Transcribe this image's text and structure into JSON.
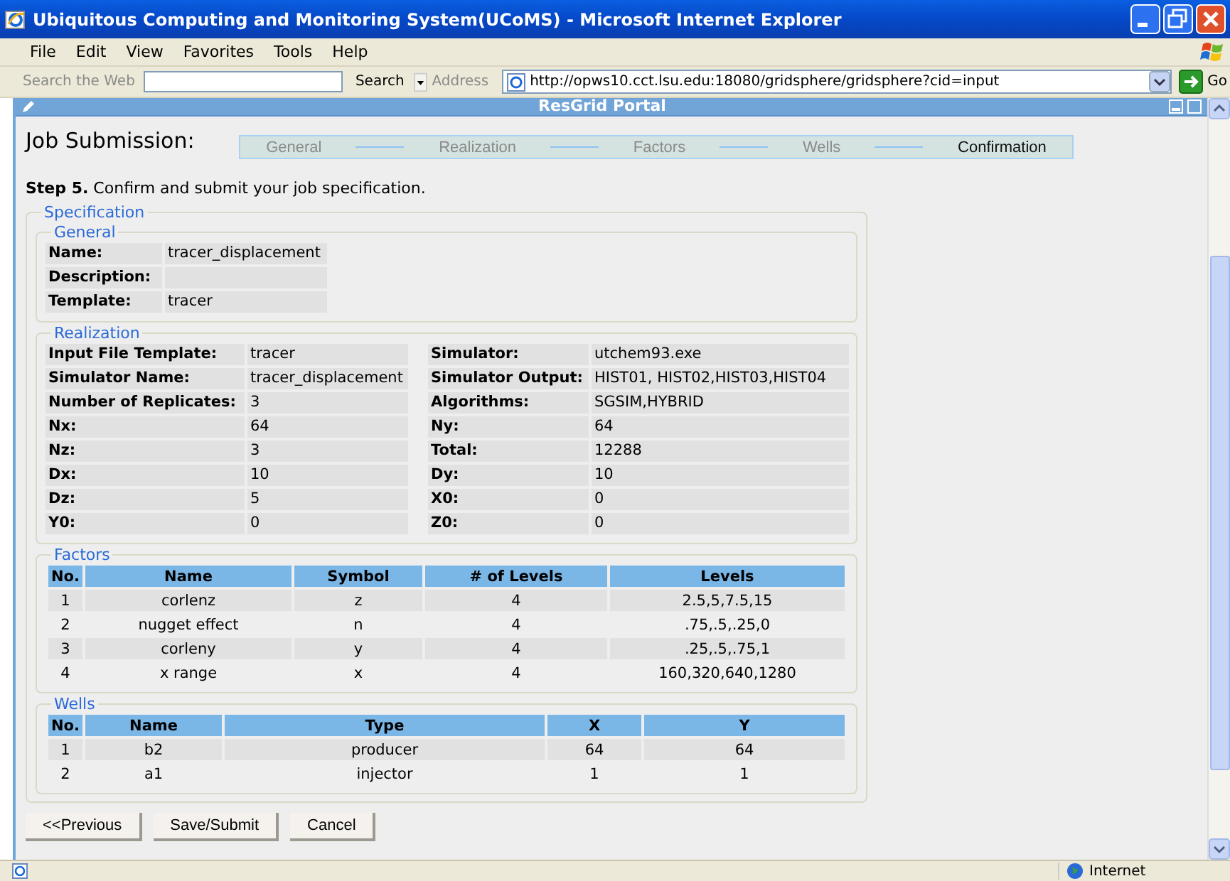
{
  "window": {
    "title": "Ubiquitous Computing and Monitoring System(UCoMS) - Microsoft Internet Explorer"
  },
  "menu": [
    "File",
    "Edit",
    "View",
    "Favorites",
    "Tools",
    "Help"
  ],
  "toolbar": {
    "search_label": "Search the Web",
    "search_button": "Search",
    "address_label": "Address",
    "address": "http://opws10.cct.lsu.edu:18080/gridsphere/gridsphere?cid=input",
    "go": "Go"
  },
  "portal": {
    "title": "ResGrid Portal"
  },
  "page": {
    "heading": "Job Submission:",
    "steps": [
      {
        "label": "General",
        "selected": false
      },
      {
        "label": "Realization",
        "selected": false
      },
      {
        "label": "Factors",
        "selected": false
      },
      {
        "label": "Wells",
        "selected": false
      },
      {
        "label": "Confirmation",
        "selected": true
      }
    ],
    "instruction": "**Step 5.** Confirm and submit your job specification.",
    "specification": {
      "legend": "Specification",
      "general": {
        "legend": "General",
        "fields": [
          {
            "label": "Name:",
            "value": "tracer_displacement"
          },
          {
            "label": "Description:"
          },
          {
            "label": "Template:",
            "value": "tracer"
          }
        ]
      },
      "realization": {
        "legend": "Realization",
        "fields": [
          {
            "label": "Input File Template:",
            "value": "tracer"
          },
          {
            "label": "Simulator:",
            "value": "utchem93.exe"
          },
          {
            "label": "Simulator Name:",
            "value": "tracer_displacement"
          },
          {
            "label": "Simulator Output:",
            "value": "HIST01, HIST02,HIST03,HIST04"
          },
          {
            "label": "Number of Replicates:",
            "value": "3"
          },
          {
            "label": "Algorithms:",
            "value": "SGSIM,HYBRID"
          },
          {
            "label": "Nx:",
            "value": "64"
          },
          {
            "label": "Ny:",
            "value": "64"
          },
          {
            "label": "Nz:",
            "value": "3"
          },
          {
            "label": "Total:",
            "value": "12288"
          },
          {
            "label": "Dx:",
            "value": "10"
          },
          {
            "label": "Dy:",
            "value": "10"
          },
          {
            "label": "Dz:",
            "value": "5"
          },
          {
            "label": "X0:",
            "value": "0"
          },
          {
            "label": "Y0:",
            "value": "0"
          },
          {
            "label": "Z0:",
            "value": "0"
          }
        ]
      },
      "factors": {
        "legend": "Factors",
        "columns": [
          "No.",
          "Name",
          "Symbol",
          "# of Levels",
          "Levels"
        ],
        "rows": [
          [
            "1",
            "corlenz",
            "z",
            "4",
            "2.5,5,7.5,15"
          ],
          [
            "2",
            "nugget effect",
            "n",
            "4",
            ".75,.5,.25,0"
          ],
          [
            "3",
            "corleny",
            "y",
            "4",
            ".25,.5,.75,1"
          ],
          [
            "4",
            "x range",
            "x",
            "4",
            "160,320,640,1280"
          ]
        ]
      },
      "wells": {
        "legend": "Wells",
        "columns": [
          "No.",
          "Name",
          "Type",
          "X",
          "Y"
        ],
        "rows": [
          [
            "1",
            "b2",
            "producer",
            "64",
            "64"
          ],
          [
            "2",
            "a1",
            "injector",
            "1",
            "1"
          ]
        ]
      }
    },
    "buttons": [
      "<<Previous",
      "Save/Submit",
      "Cancel"
    ]
  },
  "status_bar": {
    "zone": "Internet"
  }
}
